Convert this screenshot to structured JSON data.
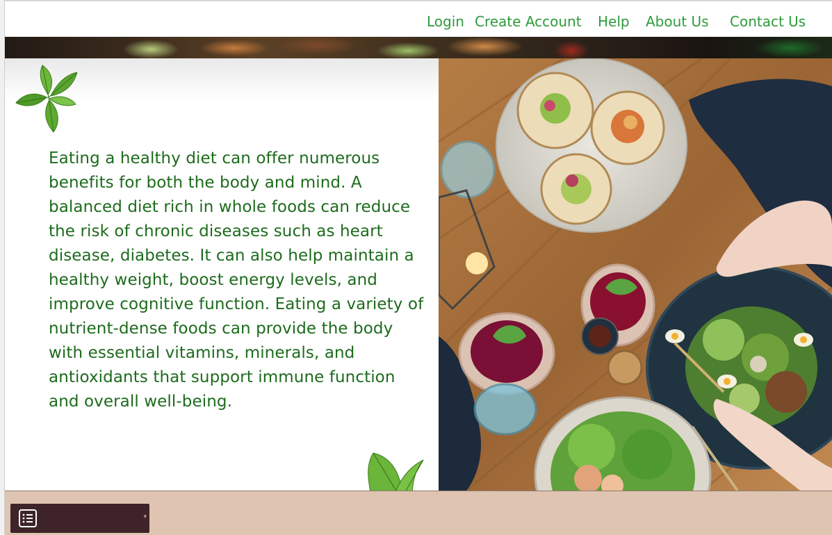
{
  "nav": {
    "links": [
      {
        "label": "Login"
      },
      {
        "label": "Create Account"
      },
      {
        "label": "Help"
      },
      {
        "label": "About Us"
      },
      {
        "label": "Contact Us"
      }
    ]
  },
  "content": {
    "paragraph": "Eating a healthy diet can offer numerous benefits for both the body and mind. A balanced diet rich in whole foods can reduce the risk of chronic diseases such as heart disease, diabetes. It can also help maintain a healthy weight, boost energy levels, and improve cognitive function. Eating a variety of nutrient-dense foods can provide the body with essential vitamins, minerals, and antioxidants that support immune function and overall well-being."
  },
  "footer": {
    "menu_icon": "list-menu-icon"
  },
  "colors": {
    "nav_link": "#2e9b3c",
    "body_text": "#1d6b1d",
    "footer_bg": "#dfc4b1",
    "menu_bg": "#3e2428"
  }
}
